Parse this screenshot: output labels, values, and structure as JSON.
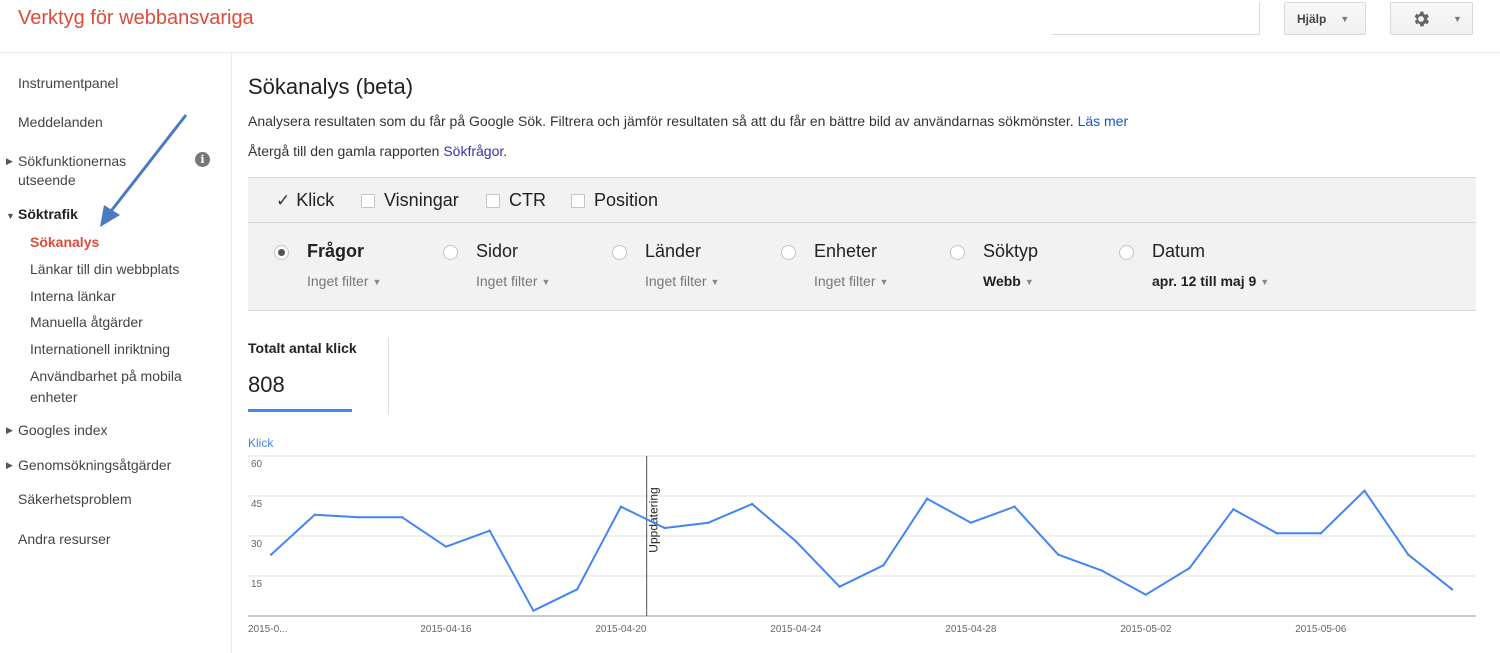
{
  "header": {
    "app_title": "Verktyg för webbansvariga",
    "help_label": "Hjälp"
  },
  "sidebar": {
    "items": [
      {
        "label": "Instrumentpanel"
      },
      {
        "label": "Meddelanden"
      },
      {
        "label_line1": "Sökfunktionernas",
        "label_line2": "utseende"
      },
      {
        "label": "Söktrafik"
      },
      {
        "label": "Googles index"
      },
      {
        "label": "Genomsökningsåtgärder"
      },
      {
        "label": "Säkerhetsproblem"
      },
      {
        "label": "Andra resurser"
      }
    ],
    "subitems": [
      {
        "label": "Sökanalys"
      },
      {
        "label": "Länkar till din webbplats"
      },
      {
        "label": "Interna länkar"
      },
      {
        "label": "Manuella åtgärder"
      },
      {
        "label": "Internationell inriktning"
      },
      {
        "label_line1": "Användbarhet på mobila",
        "label_line2": "enheter"
      }
    ]
  },
  "main": {
    "title": "Sökanalys (beta)",
    "description": "Analysera resultaten som du får på Google Sök. Filtrera och jämför resultaten så att du får en bättre bild av användarnas sökmönster.",
    "learn_more": "Läs mer",
    "old_report_prefix": "Återgå till den gamla rapporten",
    "old_report_link": "Sökfrågor",
    "old_report_suffix": "."
  },
  "metrics": [
    {
      "label": "Klick",
      "checked": true
    },
    {
      "label": "Visningar",
      "checked": false
    },
    {
      "label": "CTR",
      "checked": false
    },
    {
      "label": "Position",
      "checked": false
    }
  ],
  "dimensions": [
    {
      "label": "Frågor",
      "filter": "Inget filter",
      "selected": true
    },
    {
      "label": "Sidor",
      "filter": "Inget filter",
      "selected": false
    },
    {
      "label": "Länder",
      "filter": "Inget filter",
      "selected": false
    },
    {
      "label": "Enheter",
      "filter": "Inget filter",
      "selected": false
    },
    {
      "label": "Söktyp",
      "filter": "Webb",
      "selected": false
    },
    {
      "label": "Datum",
      "filter": "apr. 12 till maj 9",
      "selected": false
    }
  ],
  "totals": {
    "label": "Totalt antal klick",
    "value": "808"
  },
  "colors": {
    "brand": "#dd4b39",
    "series": "#4285f4"
  },
  "chart_data": {
    "type": "line",
    "ylabel": "Klick",
    "ylim": [
      0,
      60
    ],
    "yticks": [
      "60",
      "45",
      "30",
      "15"
    ],
    "x": [
      "2015-04-12",
      "2015-04-13",
      "2015-04-14",
      "2015-04-15",
      "2015-04-16",
      "2015-04-17",
      "2015-04-18",
      "2015-04-19",
      "2015-04-20",
      "2015-04-21",
      "2015-04-22",
      "2015-04-23",
      "2015-04-24",
      "2015-04-25",
      "2015-04-26",
      "2015-04-27",
      "2015-04-28",
      "2015-04-29",
      "2015-04-30",
      "2015-05-01",
      "2015-05-02",
      "2015-05-03",
      "2015-05-04",
      "2015-05-05",
      "2015-05-06",
      "2015-05-07",
      "2015-05-08",
      "2015-05-09"
    ],
    "xtick_labels": [
      {
        "x": "2015-04-12",
        "label": "2015-0..."
      },
      {
        "x": "2015-04-16",
        "label": "2015-04-16"
      },
      {
        "x": "2015-04-20",
        "label": "2015-04-20"
      },
      {
        "x": "2015-04-24",
        "label": "2015-04-24"
      },
      {
        "x": "2015-04-28",
        "label": "2015-04-28"
      },
      {
        "x": "2015-05-02",
        "label": "2015-05-02"
      },
      {
        "x": "2015-05-06",
        "label": "2015-05-06"
      }
    ],
    "series": [
      {
        "values": [
          23,
          38,
          37,
          37,
          26,
          32,
          2,
          10,
          41,
          33,
          35,
          42,
          28,
          11,
          19,
          44,
          35,
          41,
          23,
          17,
          8,
          18,
          40,
          31,
          31,
          47,
          23,
          10
        ]
      }
    ],
    "annotation": {
      "x": "2015-04-21",
      "label": "Uppdatering"
    },
    "grid": true
  }
}
